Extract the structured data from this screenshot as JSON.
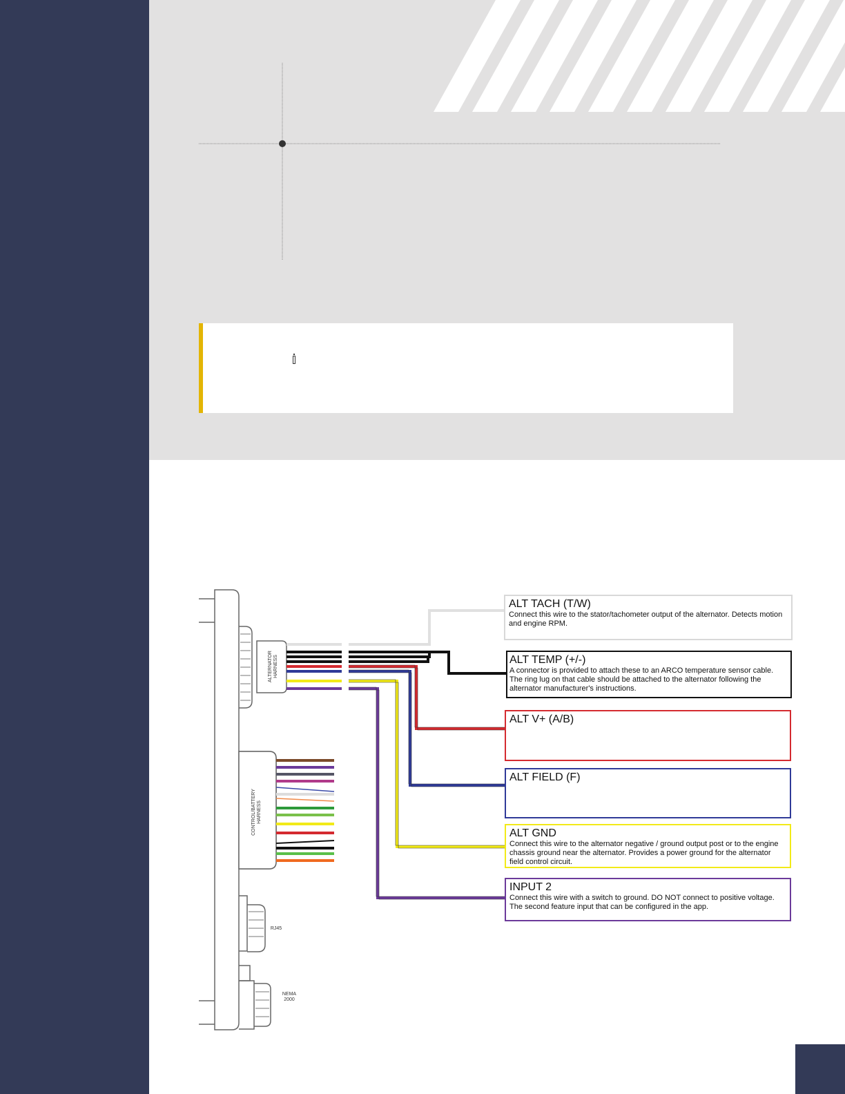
{
  "colors": {
    "sidebar": "#333a57",
    "header_panel": "#e2e1e1",
    "note_accent": "#e3b505",
    "wire_white": "#e6e6e6",
    "wire_black": "#111111",
    "wire_red": "#d42a2f",
    "wire_blue": "#2f3a98",
    "wire_yellow": "#f2ea18",
    "wire_purple": "#6b3a9a"
  },
  "note": {
    "icon": "info-icon"
  },
  "diagram": {
    "labels": {
      "alternator_harness": "ALTERNATOR HARNESS",
      "control_harness": "CONTROL/BATTERY HARNESS",
      "rj45": "RJ45",
      "nema": "NEMA 2000"
    },
    "wire_boxes": [
      {
        "id": "alt-tach",
        "title": "ALT TACH (T/W)",
        "description": "Connect this wire to the stator/tachometer output of the alternator. Detects motion and engine RPM.",
        "color": "#e0e0e0"
      },
      {
        "id": "alt-temp",
        "title": "ALT TEMP (+/-)",
        "description": "A connector is provided to attach these to an ARCO temperature sensor cable. The ring lug on that cable should be attached to the alternator following the alternator manufacturer's instructions.",
        "color": "#111111"
      },
      {
        "id": "alt-vplus",
        "title": "ALT V+ (A/B)",
        "description": "",
        "color": "#d42a2f"
      },
      {
        "id": "alt-field",
        "title": "ALT FIELD (F)",
        "description": "",
        "color": "#2f3a98"
      },
      {
        "id": "alt-gnd",
        "title": "ALT GND",
        "description": "Connect this wire to the alternator negative / ground output post or to the engine chassis ground near the alternator. Provides a power ground for the alternator field control circuit.",
        "color": "#f2ea18"
      },
      {
        "id": "input-2",
        "title": "INPUT 2",
        "description": "Connect this wire with a switch to ground. DO NOT connect to positive voltage. The second feature input that can be configured in the app.",
        "color": "#6b3a9a"
      }
    ]
  }
}
